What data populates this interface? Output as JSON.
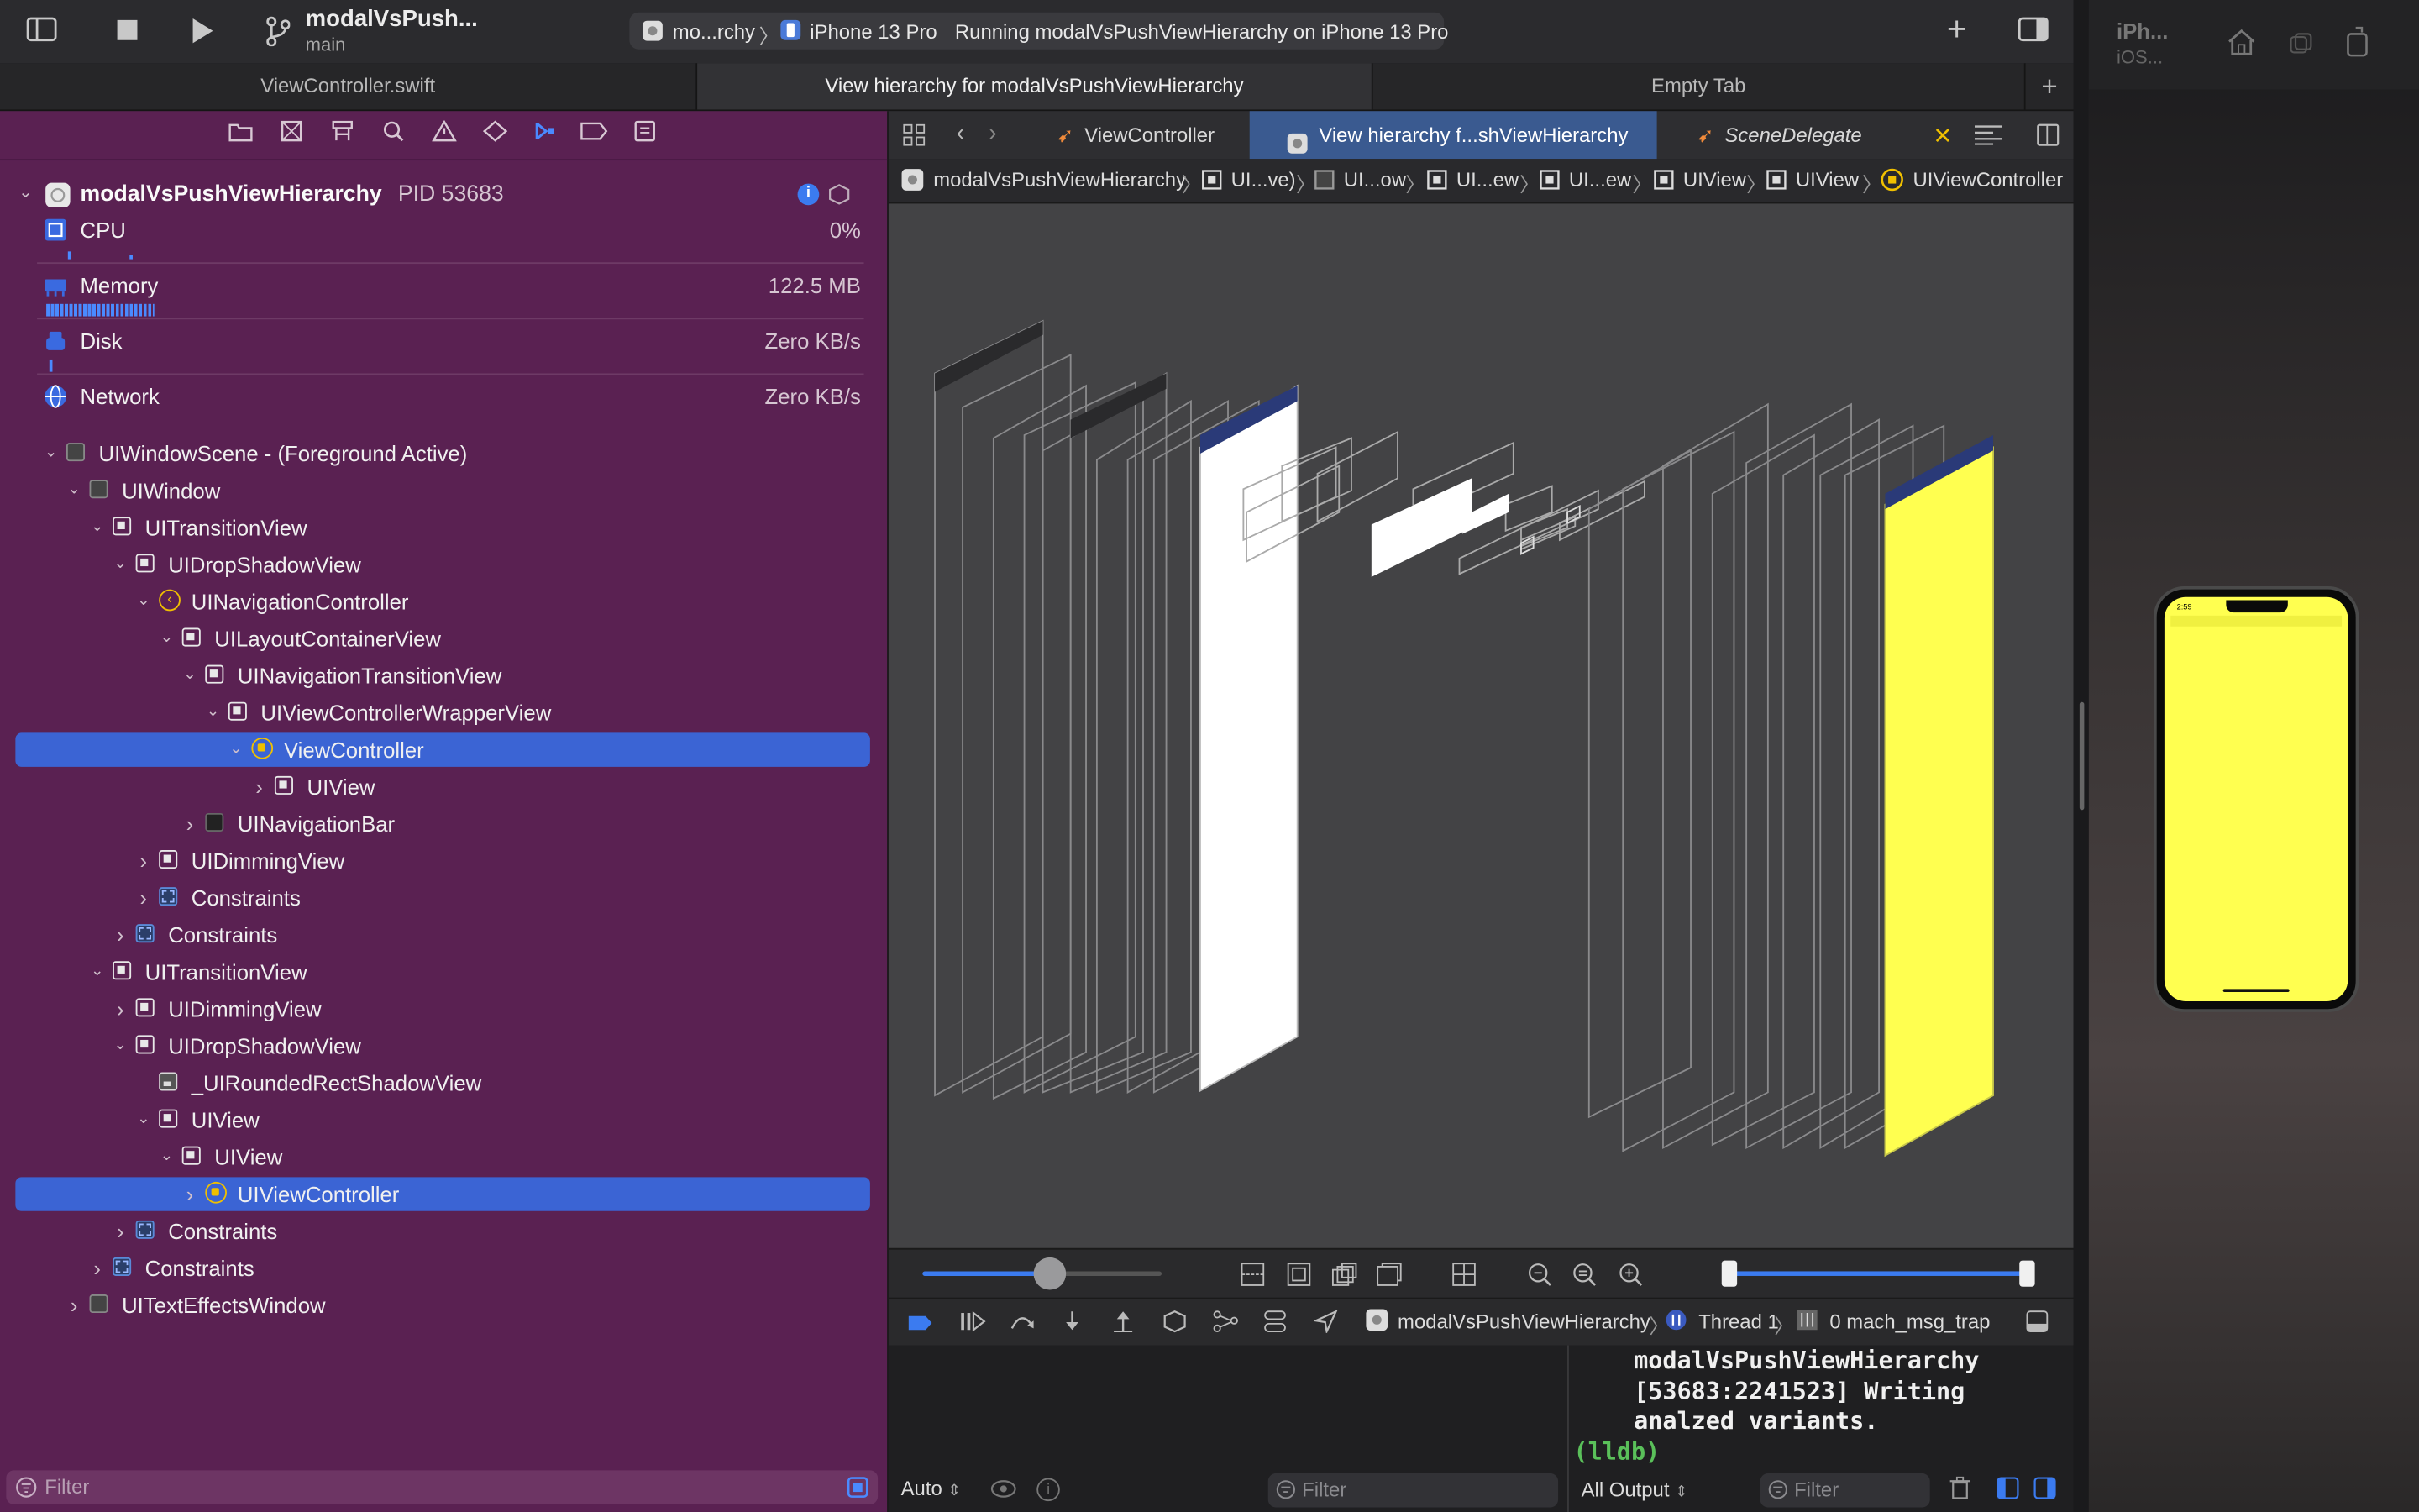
{
  "toolbar": {
    "project_name": "modalVsPush...",
    "branch": "main",
    "scheme_short": "mo...rchy",
    "device": "iPhone 13 Pro",
    "status": "Running modalVsPushViewHierarchy on iPhone 13 Pro"
  },
  "tabs": [
    {
      "label": "ViewController.swift",
      "active": false
    },
    {
      "label": "View hierarchy for modalVsPushViewHierarchy",
      "active": true
    },
    {
      "label": "Empty Tab",
      "active": false
    }
  ],
  "navigator": {
    "process": {
      "name": "modalVsPushViewHierarchy",
      "pid": "PID 53683"
    },
    "gauges": [
      {
        "label": "CPU",
        "value": "0%",
        "icon": "cpu-icon"
      },
      {
        "label": "Memory",
        "value": "122.5 MB",
        "icon": "memory-icon"
      },
      {
        "label": "Disk",
        "value": "Zero KB/s",
        "icon": "disk-icon"
      },
      {
        "label": "Network",
        "value": "Zero KB/s",
        "icon": "network-icon"
      }
    ],
    "tree": [
      {
        "label": "UIWindowScene - (Foreground Active)",
        "depth": 0,
        "icon": "plain"
      },
      {
        "label": "UIWindow",
        "depth": 1,
        "icon": "plain"
      },
      {
        "label": "UITransitionView",
        "depth": 2,
        "icon": "view"
      },
      {
        "label": "UIDropShadowView",
        "depth": 3,
        "icon": "view"
      },
      {
        "label": "UINavigationController",
        "depth": 4,
        "icon": "navcontroller"
      },
      {
        "label": "UILayoutContainerView",
        "depth": 5,
        "icon": "view"
      },
      {
        "label": "UINavigationTransitionView",
        "depth": 6,
        "icon": "view"
      },
      {
        "label": "UIViewControllerWrapperView",
        "depth": 7,
        "icon": "view"
      },
      {
        "label": "ViewController",
        "depth": 8,
        "icon": "controller",
        "selected": true
      },
      {
        "label": "UIView",
        "depth": 9,
        "icon": "view"
      },
      {
        "label": "UINavigationBar",
        "depth": 6,
        "icon": "navbar"
      },
      {
        "label": "UIDimmingView",
        "depth": 4,
        "icon": "view"
      },
      {
        "label": "Constraints",
        "depth": 4,
        "icon": "constraints"
      },
      {
        "label": "Constraints",
        "depth": 3,
        "icon": "constraints"
      },
      {
        "label": "UITransitionView",
        "depth": 2,
        "icon": "view"
      },
      {
        "label": "UIDimmingView",
        "depth": 3,
        "icon": "view"
      },
      {
        "label": "UIDropShadowView",
        "depth": 3,
        "icon": "view"
      },
      {
        "label": "_UIRoundedRectShadowView",
        "depth": 4,
        "icon": "image"
      },
      {
        "label": "UIView",
        "depth": 4,
        "icon": "view"
      },
      {
        "label": "UIView",
        "depth": 5,
        "icon": "view"
      },
      {
        "label": "UIViewController",
        "depth": 6,
        "icon": "controller",
        "selected": true
      },
      {
        "label": "Constraints",
        "depth": 3,
        "icon": "constraints"
      },
      {
        "label": "Constraints",
        "depth": 2,
        "icon": "constraints"
      },
      {
        "label": "UITextEffectsWindow",
        "depth": 1,
        "icon": "plain"
      }
    ],
    "filter_placeholder": "Filter"
  },
  "editor": {
    "tabs": [
      {
        "label": "ViewController",
        "active": false
      },
      {
        "label": "View hierarchy f...shViewHierarchy",
        "active": true
      },
      {
        "label": "SceneDelegate",
        "active": false
      }
    ],
    "breadcrumb": [
      "modalVsPushViewHierarchy",
      "UI...ve)",
      "UI...ow",
      "UI...ew",
      "UI...ew",
      "UIView",
      "UIView",
      "UIViewController"
    ],
    "debug_bar": {
      "process": "modalVsPushViewHierarchy",
      "thread": "Thread 1",
      "frame": "0 mach_msg_trap"
    },
    "variables": {
      "scope": "Auto"
    },
    "console": {
      "lines": [
        "modalVsPushViewHierarchy",
        "[53683:2241523] Writing",
        "analzed variants."
      ],
      "prompt": "(lldb)",
      "output_filter": "All Output"
    },
    "filter_placeholder": "Filter"
  },
  "simulator": {
    "title": "iPh...",
    "subtitle": "iOS...",
    "status_time": "2:59",
    "screen_color": "#ffff50"
  },
  "colors": {
    "navigator_bg": "#5a2152",
    "selection": "#3b64d4",
    "canvas_bg": "#434345",
    "accent_yellow": "#ffff50"
  }
}
